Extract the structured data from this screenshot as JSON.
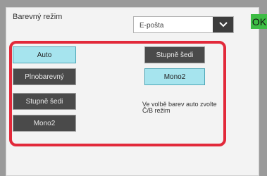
{
  "dialog": {
    "title": "Barevný režim",
    "ok_label": "OK"
  },
  "destination": {
    "value": "E-pošta"
  },
  "left_options": [
    {
      "label": "Auto",
      "selected": true
    },
    {
      "label": "Plnobarevný",
      "selected": false
    },
    {
      "label": "Stupně šedi",
      "selected": false
    },
    {
      "label": "Mono2",
      "selected": false
    }
  ],
  "right_options": [
    {
      "label": "Stupně šedi",
      "selected": false
    },
    {
      "label": "Mono2",
      "selected": true
    }
  ],
  "note": "Ve volbě barev auto zvolte Č/B režim",
  "colors": {
    "highlight": "#e2293a",
    "selected": "#a6e4ee",
    "ok": "#3dbd44"
  }
}
